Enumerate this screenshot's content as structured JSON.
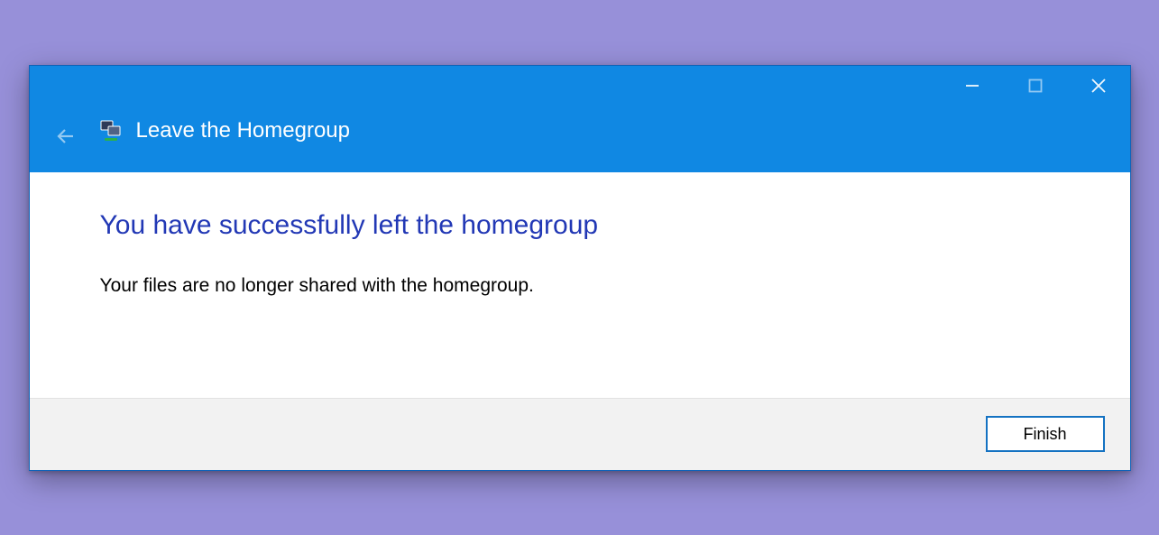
{
  "window": {
    "title": "Leave the Homegroup",
    "controls": {
      "minimize": "Minimize",
      "maximize": "Maximize",
      "close": "Close"
    }
  },
  "content": {
    "heading": "You have successfully left the homegroup",
    "body": "Your files are no longer shared with the homegroup."
  },
  "footer": {
    "finish_label": "Finish"
  },
  "icons": {
    "app": "homegroup-icon",
    "back": "back-arrow-icon",
    "minimize": "minimize-icon",
    "maximize": "maximize-icon",
    "close": "close-icon"
  },
  "colors": {
    "titlebar": "#1088e3",
    "heading": "#2238b5",
    "page_bg": "#9790d9",
    "footer_bg": "#f2f2f2",
    "button_border": "#1472c2"
  }
}
